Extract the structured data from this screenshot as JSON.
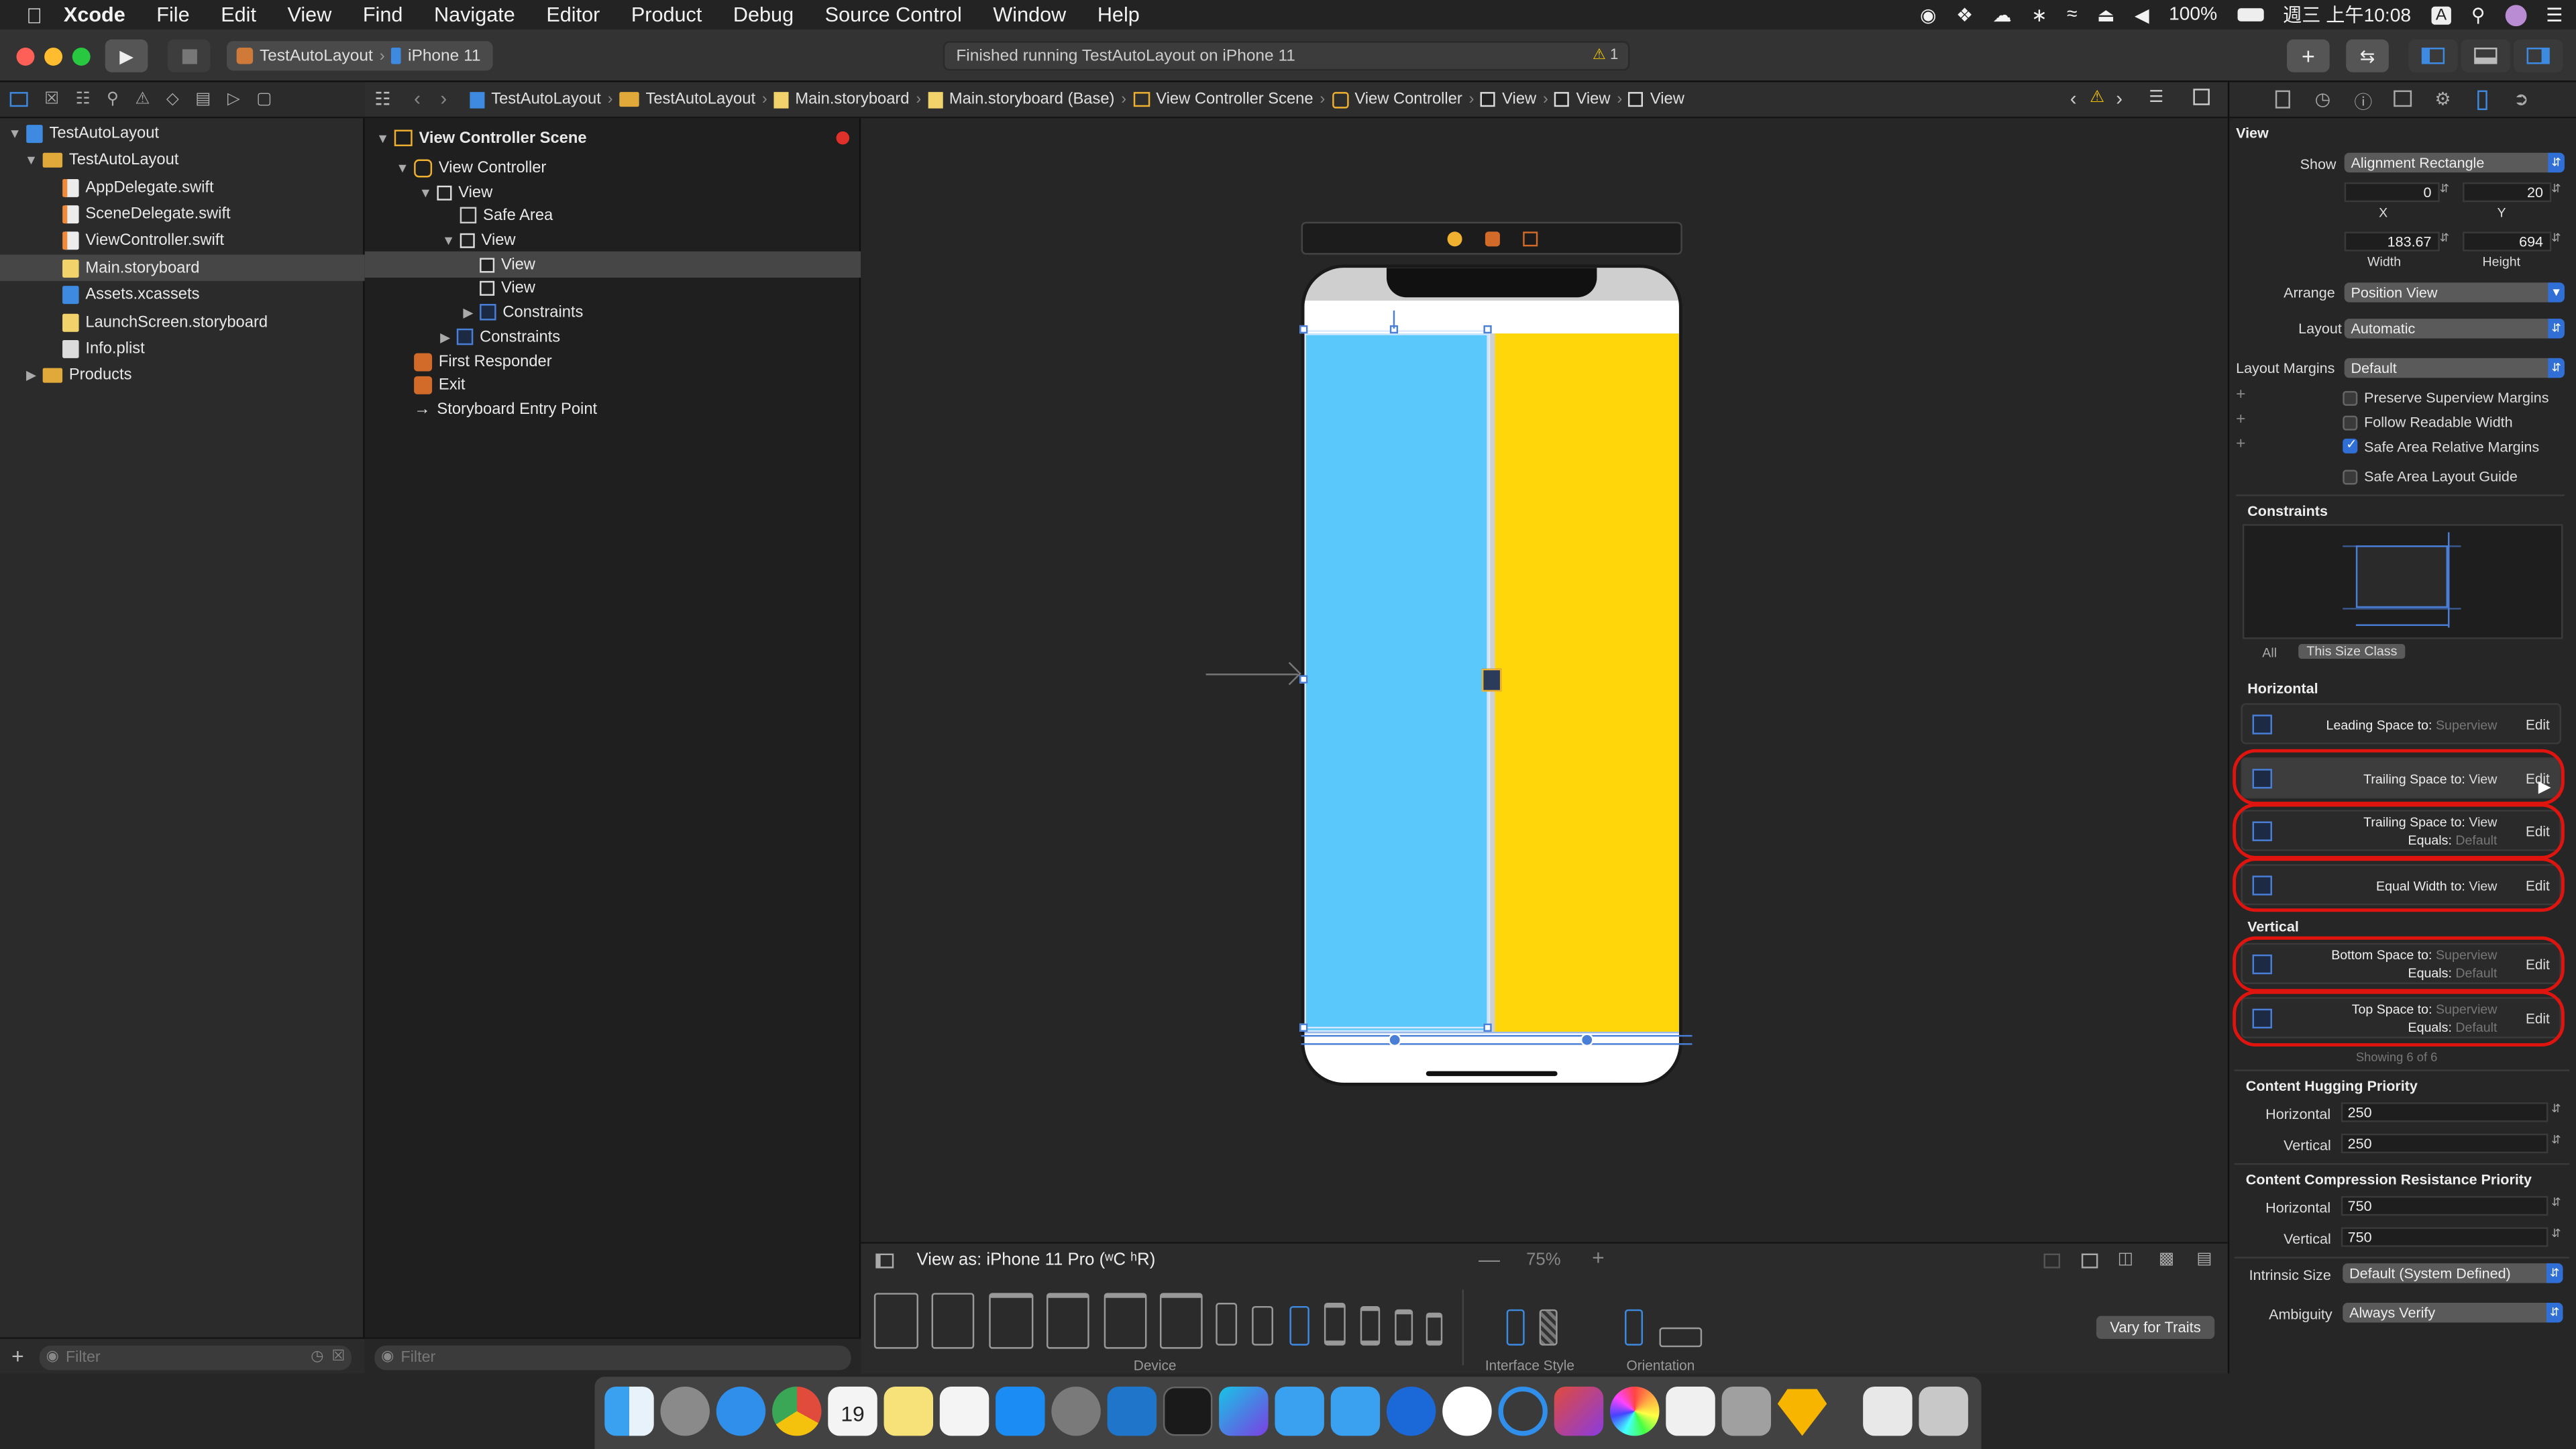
{
  "menubar": {
    "app": "Xcode",
    "items": [
      "File",
      "Edit",
      "View",
      "Find",
      "Navigate",
      "Editor",
      "Product",
      "Debug",
      "Source Control",
      "Window",
      "Help"
    ],
    "battery": "100%",
    "clock": "週三 上午10:08",
    "input_method": "A"
  },
  "toolbar": {
    "scheme": "TestAutoLayout",
    "destination": "iPhone 11",
    "activity": "Finished running TestAutoLayout on iPhone 11",
    "warning_count": "1"
  },
  "navigator": {
    "items": [
      {
        "label": "TestAutoLayout",
        "kind": "project"
      },
      {
        "label": "TestAutoLayout",
        "kind": "folder"
      },
      {
        "label": "AppDelegate.swift",
        "kind": "swift"
      },
      {
        "label": "SceneDelegate.swift",
        "kind": "swift"
      },
      {
        "label": "ViewController.swift",
        "kind": "swift"
      },
      {
        "label": "Main.storyboard",
        "kind": "storyboard"
      },
      {
        "label": "Assets.xcassets",
        "kind": "assets"
      },
      {
        "label": "LaunchScreen.storyboard",
        "kind": "storyboard"
      },
      {
        "label": "Info.plist",
        "kind": "plist"
      },
      {
        "label": "Products",
        "kind": "folder"
      }
    ],
    "filter_placeholder": "Filter"
  },
  "jumpbar": {
    "crumbs": [
      "TestAutoLayout",
      "TestAutoLayout",
      "Main.storyboard",
      "Main.storyboard (Base)",
      "View Controller Scene",
      "View Controller",
      "View",
      "View",
      "View"
    ]
  },
  "outline": {
    "items": [
      "View Controller Scene",
      "View Controller",
      "View",
      "Safe Area",
      "View",
      "View",
      "View",
      "Constraints",
      "Constraints",
      "First Responder",
      "Exit",
      "Storyboard Entry Point"
    ],
    "filter_placeholder": "Filter"
  },
  "canvas": {
    "left_color": "#5AC8FA",
    "right_color": "#FFD60A",
    "view_as": "View as: iPhone 11 Pro (ʷC ʰR)",
    "zoom": "75%",
    "device_label": "Device",
    "interface_style_label": "Interface Style",
    "orientation_label": "Orientation",
    "vary_button": "Vary for Traits"
  },
  "inspector": {
    "section_view": "View",
    "show_label": "Show",
    "show_value": "Alignment Rectangle",
    "x_value": "0",
    "y_value": "20",
    "x_label": "X",
    "y_label": "Y",
    "width_value": "183.67",
    "height_value": "694",
    "width_label": "Width",
    "height_label": "Height",
    "arrange_label": "Arrange",
    "arrange_value": "Position View",
    "layout_label": "Layout",
    "layout_value": "Automatic",
    "margins_label": "Layout Margins",
    "margins_value": "Default",
    "checks": [
      {
        "label": "Preserve Superview Margins",
        "checked": false
      },
      {
        "label": "Follow Readable Width",
        "checked": false
      },
      {
        "label": "Safe Area Relative Margins",
        "checked": true
      },
      {
        "label": "Safe Area Layout Guide",
        "checked": false
      }
    ],
    "constraints_header": "Constraints",
    "seg_all": "All",
    "seg_size_class": "This Size Class",
    "horizontal_header": "Horizontal",
    "vertical_header": "Vertical",
    "edit_label": "Edit",
    "constraints": [
      {
        "title": "Leading Space to:",
        "target": "Superview",
        "target_dim": true,
        "equals": "",
        "group": "h"
      },
      {
        "title": "Trailing Space to:",
        "target": "View",
        "target_dim": false,
        "equals": "",
        "group": "h"
      },
      {
        "title": "Trailing Space to:",
        "target": "View",
        "target_dim": false,
        "equals": "Default",
        "group": "h"
      },
      {
        "title": "Equal Width to:",
        "target": "View",
        "target_dim": false,
        "equals": "",
        "group": "h"
      },
      {
        "title": "Bottom Space to:",
        "target": "Superview",
        "target_dim": true,
        "equals": "Default",
        "group": "v"
      },
      {
        "title": "Top Space to:",
        "target": "Superview",
        "target_dim": true,
        "equals": "Default",
        "group": "v"
      }
    ],
    "equals_label": "Equals:",
    "showing": "Showing 6 of 6",
    "hugging_header": "Content Hugging Priority",
    "hugging_h_label": "Horizontal",
    "hugging_h": "250",
    "hugging_v_label": "Vertical",
    "hugging_v": "250",
    "compression_header": "Content Compression Resistance Priority",
    "compression_h_label": "Horizontal",
    "compression_h": "750",
    "compression_v_label": "Vertical",
    "compression_v": "750",
    "intrinsic_label": "Intrinsic Size",
    "intrinsic_value": "Default (System Defined)",
    "ambiguity_label": "Ambiguity",
    "ambiguity_value": "Always Verify"
  },
  "dock": {
    "calendar_day": "19",
    "apps": [
      "finder-icon",
      "launchpad-icon",
      "safari-icon",
      "chrome-icon",
      "calendar-icon",
      "notes-icon",
      "reminders-icon",
      "app-store-icon",
      "system-preferences-icon",
      "vscode-icon",
      "terminal-icon",
      "webstorm-icon",
      "xcode-icon",
      "instruments-icon",
      "sourcetree-icon",
      "slack-icon",
      "sourcetree-alt-icon",
      "final-cut-icon",
      "color-icon",
      "textedit-icon",
      "archive-icon",
      "sketch-icon",
      "simulator-icon",
      "trash-icon"
    ]
  }
}
